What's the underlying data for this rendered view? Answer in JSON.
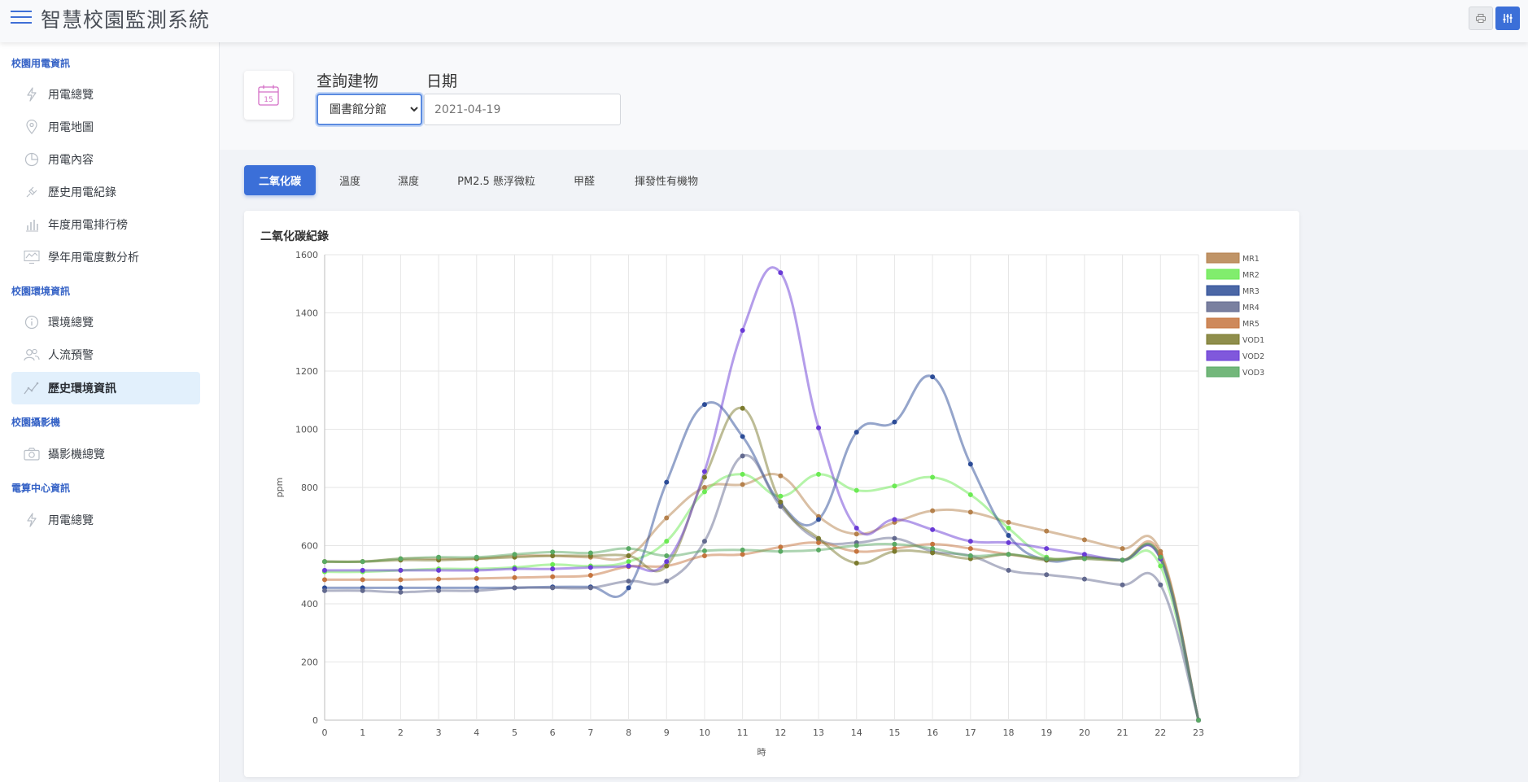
{
  "app": {
    "title": "智慧校園監測系統",
    "menu_icon": "hamburger-icon"
  },
  "toolbar": {
    "icons": [
      "printer-icon",
      "sliders-icon"
    ]
  },
  "sidebar": {
    "sections": [
      {
        "title": "校園用電資訊",
        "items": [
          {
            "label": "用電總覽",
            "icon": "lightning-icon"
          },
          {
            "label": "用電地圖",
            "icon": "map-pin-icon"
          },
          {
            "label": "用電內容",
            "icon": "pie-chart-icon"
          },
          {
            "label": "歷史用電紀錄",
            "icon": "plug-icon"
          },
          {
            "label": "年度用電排行榜",
            "icon": "bar-chart-icon"
          },
          {
            "label": "學年用電度數分析",
            "icon": "monitor-chart-icon"
          }
        ]
      },
      {
        "title": "校園環境資訊",
        "items": [
          {
            "label": "環境總覽",
            "icon": "info-icon"
          },
          {
            "label": "人流預警",
            "icon": "people-icon"
          },
          {
            "label": "歷史環境資訊",
            "icon": "trend-line-icon",
            "active": true
          }
        ]
      },
      {
        "title": "校園攝影機",
        "items": [
          {
            "label": "攝影機總覽",
            "icon": "camera-icon"
          }
        ]
      },
      {
        "title": "電算中心資訊",
        "items": [
          {
            "label": "用電總覽",
            "icon": "lightning-icon"
          }
        ]
      }
    ]
  },
  "query": {
    "calendar_day": "15",
    "building_label": "查詢建物",
    "building_value": "圖書館分館",
    "date_label": "日期",
    "date_placeholder": "2021-04-19"
  },
  "tabs": [
    {
      "label": "二氧化碳",
      "active": true
    },
    {
      "label": "溫度"
    },
    {
      "label": "濕度"
    },
    {
      "label": "PM2.5 懸浮微粒"
    },
    {
      "label": "甲醛"
    },
    {
      "label": "揮發性有機物"
    }
  ],
  "card": {
    "title": "二氧化碳紀錄"
  },
  "chart_data": {
    "type": "line",
    "x": [
      0,
      1,
      2,
      3,
      4,
      5,
      6,
      7,
      8,
      9,
      10,
      11,
      12,
      13,
      14,
      15,
      16,
      17,
      18,
      19,
      20,
      21,
      22,
      23
    ],
    "xlabel": "時",
    "ylabel": "ppm",
    "ylim": [
      0,
      1600
    ],
    "yticks": [
      0,
      200,
      400,
      600,
      800,
      1000,
      1200,
      1400,
      1600
    ],
    "grid": true,
    "legend": "right",
    "series": [
      {
        "name": "MR1",
        "color": "#b5814c",
        "values": [
          545,
          545,
          555,
          555,
          555,
          565,
          565,
          560,
          565,
          695,
          800,
          810,
          840,
          700,
          640,
          680,
          720,
          715,
          680,
          650,
          620,
          590,
          580,
          0
        ]
      },
      {
        "name": "MR2",
        "color": "#6bea53",
        "values": [
          510,
          510,
          515,
          520,
          520,
          525,
          535,
          530,
          545,
          615,
          785,
          845,
          770,
          845,
          790,
          805,
          835,
          775,
          660,
          560,
          560,
          550,
          530,
          0
        ]
      },
      {
        "name": "MR3",
        "color": "#2c4c97",
        "values": [
          455,
          455,
          455,
          455,
          455,
          455,
          458,
          458,
          455,
          818,
          1085,
          975,
          745,
          690,
          990,
          1025,
          1180,
          880,
          635,
          550,
          560,
          550,
          555,
          0
        ]
      },
      {
        "name": "MR4",
        "color": "#636a8f",
        "values": [
          445,
          445,
          440,
          445,
          445,
          455,
          455,
          455,
          478,
          478,
          615,
          908,
          735,
          620,
          610,
          625,
          580,
          565,
          515,
          500,
          485,
          465,
          465,
          0
        ]
      },
      {
        "name": "MR5",
        "color": "#c5743e",
        "values": [
          483,
          483,
          483,
          485,
          487,
          490,
          493,
          498,
          528,
          530,
          565,
          570,
          595,
          610,
          580,
          590,
          605,
          590,
          570,
          555,
          555,
          550,
          570,
          0
        ]
      },
      {
        "name": "VOD1",
        "color": "#7b7a2d",
        "values": [
          545,
          545,
          550,
          550,
          555,
          560,
          565,
          565,
          565,
          530,
          835,
          1072,
          750,
          625,
          540,
          580,
          575,
          555,
          570,
          550,
          560,
          550,
          560,
          0
        ]
      },
      {
        "name": "VOD2",
        "color": "#6a3bd6",
        "values": [
          515,
          515,
          515,
          515,
          515,
          520,
          520,
          525,
          530,
          545,
          855,
          1340,
          1538,
          1005,
          660,
          690,
          655,
          615,
          610,
          590,
          570,
          550,
          555,
          0
        ]
      },
      {
        "name": "VOD3",
        "color": "#5aaa64",
        "values": [
          545,
          545,
          555,
          560,
          560,
          570,
          578,
          575,
          590,
          565,
          582,
          585,
          580,
          585,
          600,
          605,
          590,
          565,
          570,
          555,
          555,
          550,
          560,
          0
        ]
      }
    ]
  }
}
